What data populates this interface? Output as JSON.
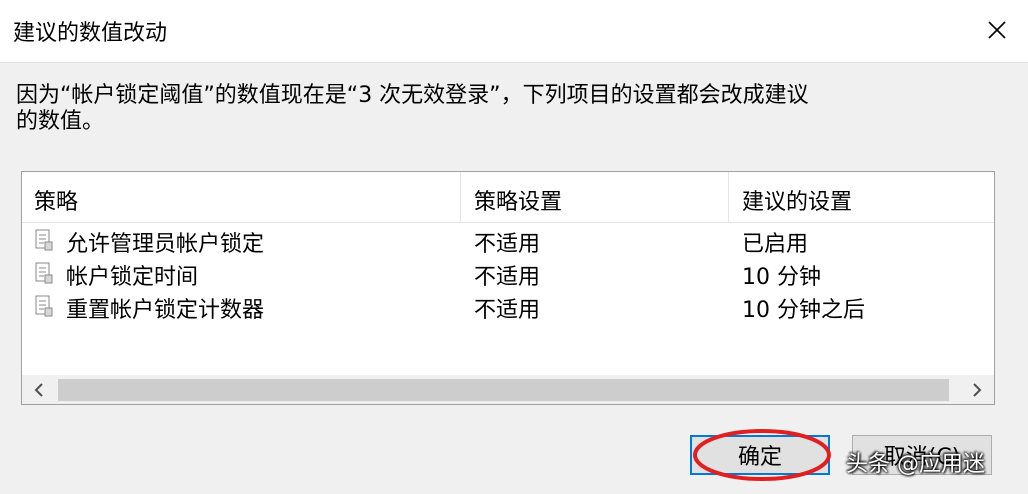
{
  "dialog": {
    "title": "建议的数值改动",
    "message": "因为“帐户锁定阈值”的数值现在是“3 次无效登录”，下列项目的设置都会改成建议\n的数值。"
  },
  "table": {
    "columns": [
      "策略",
      "策略设置",
      "建议的设置"
    ],
    "rows": [
      {
        "policy": "允许管理员帐户锁定",
        "setting": "不适用",
        "suggested": "已启用"
      },
      {
        "policy": "帐户锁定时间",
        "setting": "不适用",
        "suggested": "10 分钟"
      },
      {
        "policy": "重置帐户锁定计数器",
        "setting": "不适用",
        "suggested": "10 分钟之后"
      }
    ]
  },
  "buttons": {
    "ok": "确定",
    "cancel": "取消(C)"
  },
  "watermark": "头条 @应用迷",
  "colors": {
    "accent": "#0078d7",
    "annotation": "#e02020"
  },
  "icons": {
    "close": "close-icon",
    "row": "policy-icon",
    "scroll_left": "chevron-left-icon",
    "scroll_right": "chevron-right-icon"
  }
}
